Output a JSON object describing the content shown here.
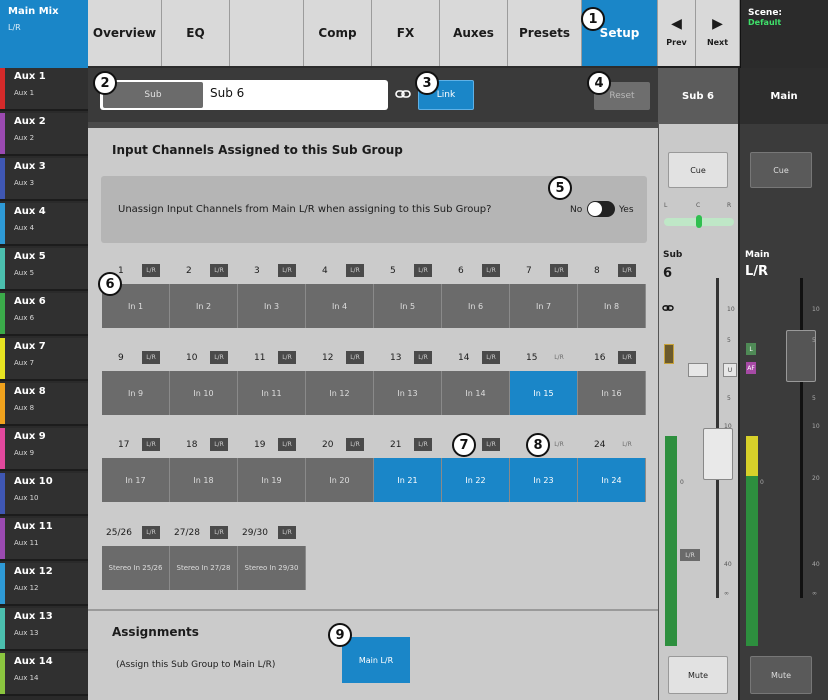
{
  "sidebar": {
    "main_mix": {
      "title": "Main Mix",
      "sub": "L/R"
    },
    "auxes": [
      {
        "title": "Aux 1",
        "sub": "Aux 1",
        "color": "#d42a2a"
      },
      {
        "title": "Aux 2",
        "sub": "Aux 2",
        "color": "#9b4ab1"
      },
      {
        "title": "Aux 3",
        "sub": "Aux 3",
        "color": "#3f57b3"
      },
      {
        "title": "Aux 4",
        "sub": "Aux 4",
        "color": "#2e9ad6"
      },
      {
        "title": "Aux 5",
        "sub": "Aux 5",
        "color": "#4bbfae"
      },
      {
        "title": "Aux 6",
        "sub": "Aux 6",
        "color": "#3bab4a"
      },
      {
        "title": "Aux 7",
        "sub": "Aux 7",
        "color": "#e7e321"
      },
      {
        "title": "Aux 8",
        "sub": "Aux 8",
        "color": "#f0a21d"
      },
      {
        "title": "Aux 9",
        "sub": "Aux 9",
        "color": "#e2489d"
      },
      {
        "title": "Aux 10",
        "sub": "Aux 10",
        "color": "#3f57b3"
      },
      {
        "title": "Aux 11",
        "sub": "Aux 11",
        "color": "#9b4ab1"
      },
      {
        "title": "Aux 12",
        "sub": "Aux 12",
        "color": "#2e9ad6"
      },
      {
        "title": "Aux 13",
        "sub": "Aux 13",
        "color": "#4bbfae"
      },
      {
        "title": "Aux 14",
        "sub": "Aux 14",
        "color": "#8bc53f"
      }
    ]
  },
  "tabs": [
    {
      "label": "Overview"
    },
    {
      "label": "EQ"
    },
    {
      "label": ""
    },
    {
      "label": "Comp"
    },
    {
      "label": "FX"
    },
    {
      "label": "Auxes"
    },
    {
      "label": "Presets"
    },
    {
      "label": "Setup",
      "active": true
    }
  ],
  "nav": {
    "prev_label": "Prev",
    "next_label": "Next",
    "prev_icon": "triangle-left-icon",
    "next_icon": "triangle-right-icon"
  },
  "scene": {
    "title": "Scene:",
    "name": "Default",
    "name_color": "#3fe06a"
  },
  "subbar": {
    "type_label": "Sub",
    "name_value": "Sub 6",
    "link_label": "Link",
    "reset_label": "Reset"
  },
  "section": {
    "title": "Input Channels Assigned to this Sub Group",
    "unassign_text": "Unassign Input Channels from Main L/R when assigning to this Sub Group?",
    "no_label": "No",
    "yes_label": "Yes"
  },
  "channels": [
    {
      "num": "1",
      "lr": "L/R",
      "lr_on": true,
      "label": "In 1",
      "on": false
    },
    {
      "num": "2",
      "lr": "L/R",
      "lr_on": true,
      "label": "In 2",
      "on": false
    },
    {
      "num": "3",
      "lr": "L/R",
      "lr_on": true,
      "label": "In 3",
      "on": false
    },
    {
      "num": "4",
      "lr": "L/R",
      "lr_on": true,
      "label": "In 4",
      "on": false
    },
    {
      "num": "5",
      "lr": "L/R",
      "lr_on": true,
      "label": "In 5",
      "on": false
    },
    {
      "num": "6",
      "lr": "L/R",
      "lr_on": true,
      "label": "In 6",
      "on": false
    },
    {
      "num": "7",
      "lr": "L/R",
      "lr_on": true,
      "label": "In 7",
      "on": false
    },
    {
      "num": "8",
      "lr": "L/R",
      "lr_on": true,
      "label": "In 8",
      "on": false
    },
    {
      "num": "9",
      "lr": "L/R",
      "lr_on": true,
      "label": "In 9",
      "on": false
    },
    {
      "num": "10",
      "lr": "L/R",
      "lr_on": true,
      "label": "In 10",
      "on": false
    },
    {
      "num": "11",
      "lr": "L/R",
      "lr_on": true,
      "label": "In 11",
      "on": false
    },
    {
      "num": "12",
      "lr": "L/R",
      "lr_on": true,
      "label": "In 12",
      "on": false
    },
    {
      "num": "13",
      "lr": "L/R",
      "lr_on": true,
      "label": "In 13",
      "on": false
    },
    {
      "num": "14",
      "lr": "L/R",
      "lr_on": true,
      "label": "In 14",
      "on": false
    },
    {
      "num": "15",
      "lr": "L/R",
      "lr_on": false,
      "label": "In 15",
      "on": true
    },
    {
      "num": "16",
      "lr": "L/R",
      "lr_on": true,
      "label": "In 16",
      "on": false
    },
    {
      "num": "17",
      "lr": "L/R",
      "lr_on": true,
      "label": "In 17",
      "on": false
    },
    {
      "num": "18",
      "lr": "L/R",
      "lr_on": true,
      "label": "In 18",
      "on": false
    },
    {
      "num": "19",
      "lr": "L/R",
      "lr_on": true,
      "label": "In 19",
      "on": false
    },
    {
      "num": "20",
      "lr": "L/R",
      "lr_on": true,
      "label": "In 20",
      "on": false
    },
    {
      "num": "21",
      "lr": "L/R",
      "lr_on": true,
      "label": "In 21",
      "on": true
    },
    {
      "num": "",
      "lr": "L/R",
      "lr_on": true,
      "label": "In 22",
      "on": true
    },
    {
      "num": "",
      "lr": "L/R",
      "lr_on": false,
      "label": "In 23",
      "on": true
    },
    {
      "num": "24",
      "lr": "L/R",
      "lr_on": false,
      "label": "In 24",
      "on": true
    }
  ],
  "stereo_channels": [
    {
      "num": "25/26",
      "lr": "L/R",
      "label": "Stereo In 25/26"
    },
    {
      "num": "27/28",
      "lr": "L/R",
      "label": "Stereo In 27/28"
    },
    {
      "num": "29/30",
      "lr": "L/R",
      "label": "Stereo In 29/30"
    }
  ],
  "assignments": {
    "title": "Assignments",
    "note": "(Assign this Sub Group to Main L/R)",
    "main_lr_label": "Main L/R"
  },
  "callouts": [
    "1",
    "2",
    "3",
    "4",
    "5",
    "6",
    "7",
    "8",
    "9"
  ],
  "sub_strip": {
    "header": "Sub 6",
    "cue_label": "Cue",
    "pan_labels": [
      "L",
      "C",
      "R"
    ],
    "name": "Sub",
    "number": "6",
    "lr_label": "L/R",
    "u_label": "U",
    "scale": [
      "10",
      "5",
      "0",
      "5",
      "10",
      "40",
      "∞"
    ],
    "mute_label": "Mute"
  },
  "main_strip": {
    "header": "Main",
    "cue_label": "Cue",
    "name": "Main",
    "sub": "L/R",
    "scale": [
      "10",
      "5",
      "0",
      "5",
      "10",
      "20",
      "40",
      "∞"
    ],
    "mute_label": "Mute"
  }
}
